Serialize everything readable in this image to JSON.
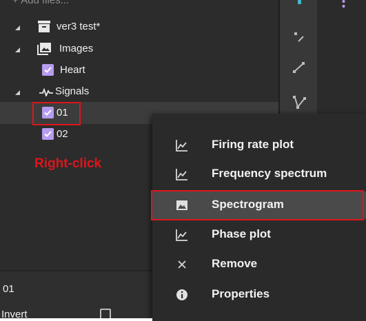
{
  "tree": {
    "add_files": "+ Add files...",
    "project": "ver3 test*",
    "images_group": "Images",
    "image_item": "Heart",
    "signals_group": "Signals",
    "signal_items": [
      "01",
      "02"
    ]
  },
  "context_menu": {
    "items": [
      {
        "label": "Firing rate plot",
        "icon": "line-chart-icon"
      },
      {
        "label": "Frequency spectrum",
        "icon": "line-chart-icon"
      },
      {
        "label": "Spectrogram",
        "icon": "image-icon"
      },
      {
        "label": "Phase plot",
        "icon": "line-chart-icon"
      },
      {
        "label": "Remove",
        "icon": "close-icon"
      },
      {
        "label": "Properties",
        "icon": "info-icon"
      }
    ]
  },
  "properties": {
    "title": "01",
    "invert_label": "Invert"
  },
  "annotation": {
    "text": "Right-click"
  },
  "colors": {
    "checkbox": "#b69cf0",
    "annotation": "#e0141a",
    "accent": "#3fb8c8"
  }
}
